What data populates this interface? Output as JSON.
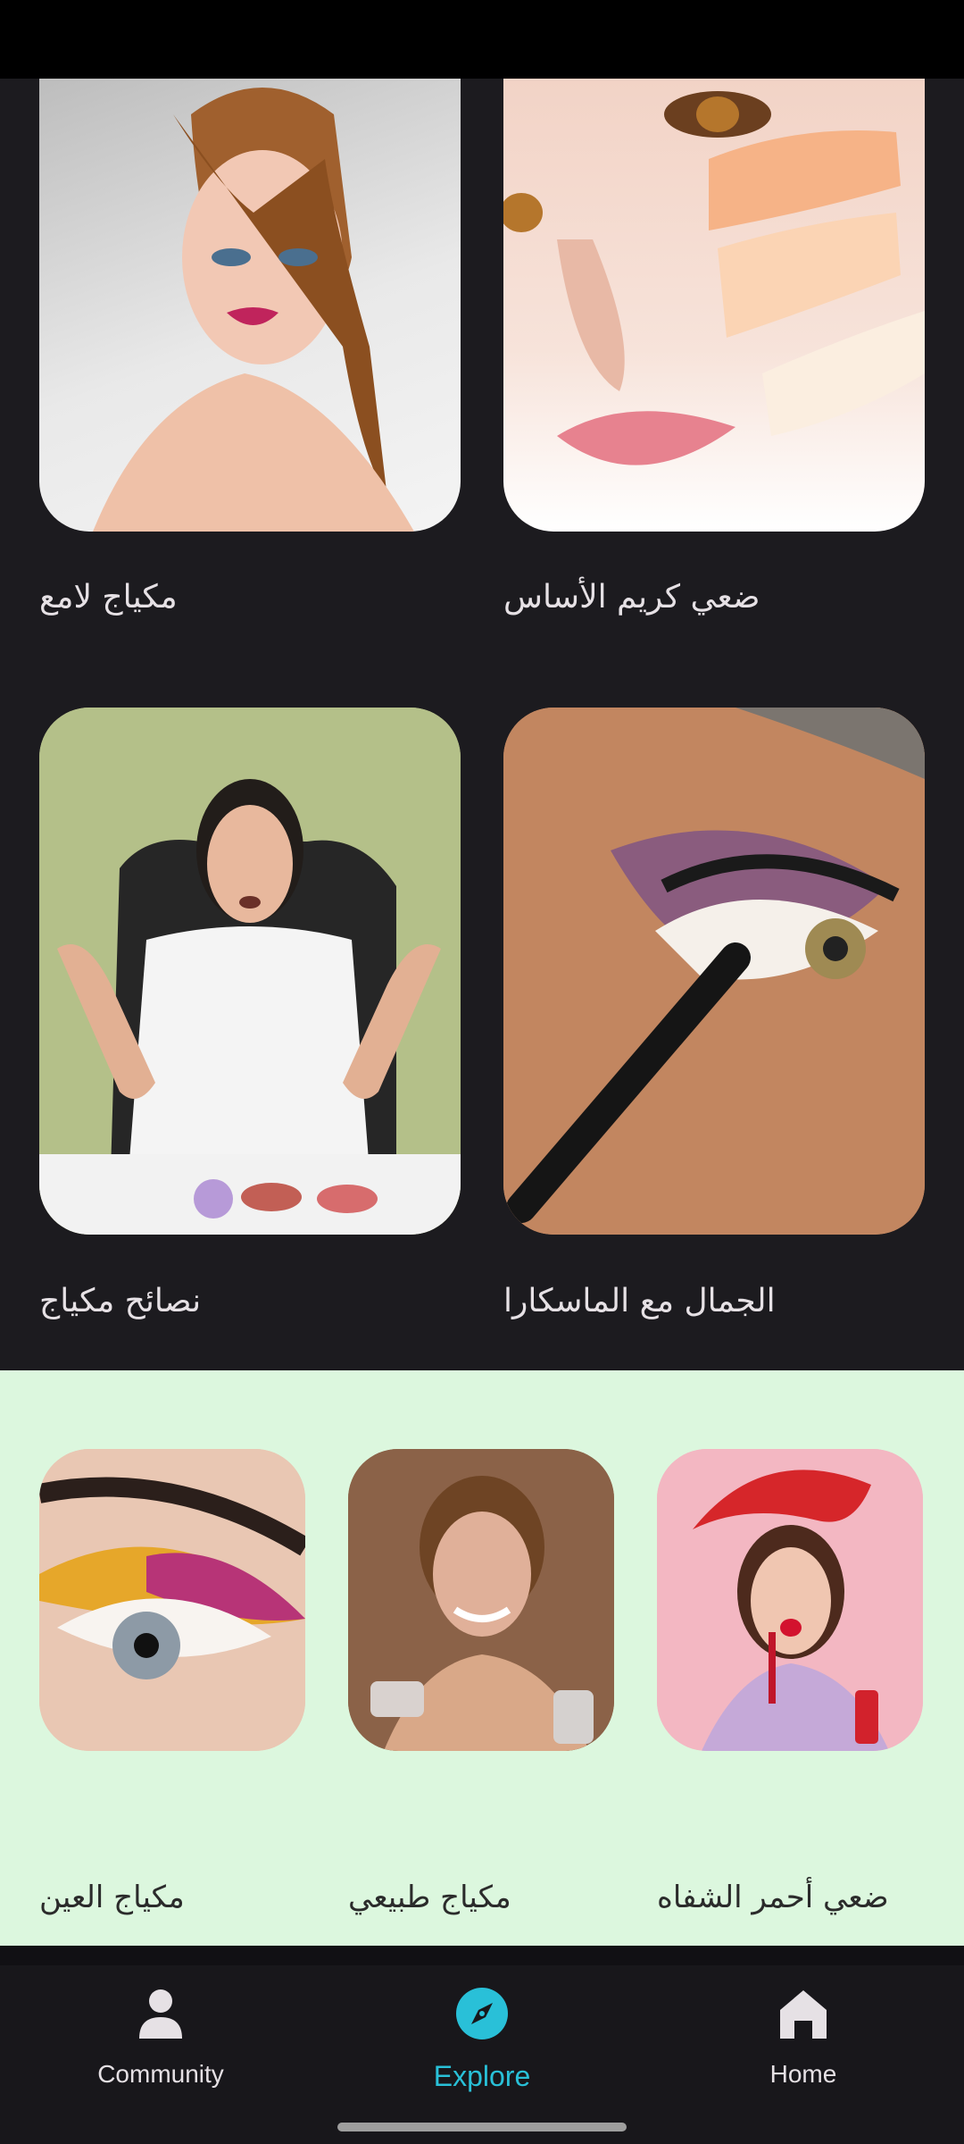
{
  "grid_cards": [
    {
      "label": "مكياج لامع"
    },
    {
      "label": "ضعي كريم الأساس"
    },
    {
      "label": "نصائح مكياج"
    },
    {
      "label": "الجمال مع الماسكارا"
    }
  ],
  "light_cards": [
    {
      "label": "مكياج العين"
    },
    {
      "label": "مكياج طبيعي"
    },
    {
      "label": "ضعي أحمر الشفاه"
    }
  ],
  "nav": {
    "community": "Community",
    "explore": "Explore",
    "home": "Home"
  },
  "colors": {
    "active": "#29c0d8",
    "light_bg": "#dcf7de",
    "dark_bg": "#1c1b1f"
  }
}
